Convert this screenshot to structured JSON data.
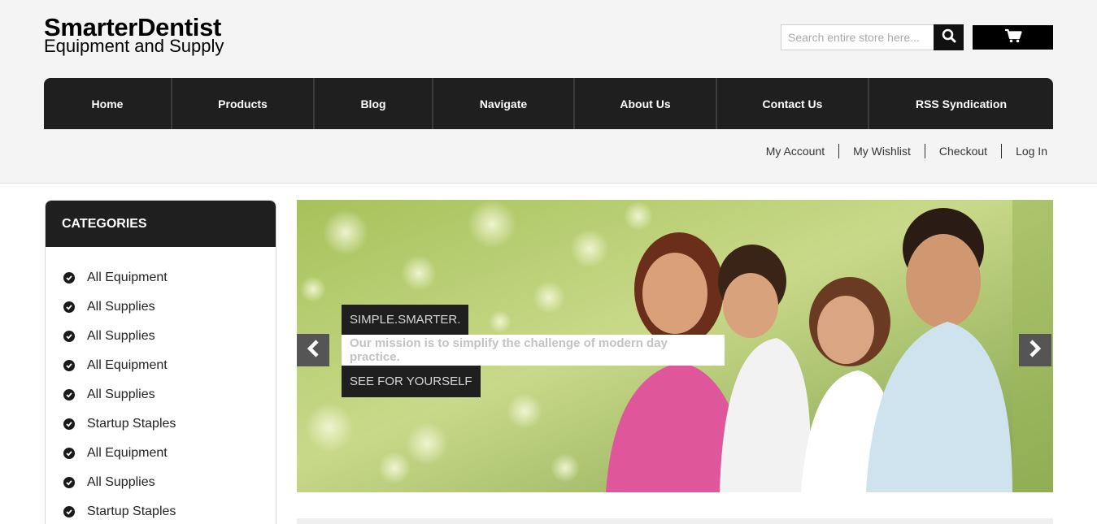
{
  "brand": {
    "title": "SmarterDentist",
    "subtitle": "Equipment and Supply"
  },
  "search": {
    "placeholder": "Search entire store here...",
    "icon": "search-icon"
  },
  "cart": {
    "icon": "shopping-cart-icon"
  },
  "nav": {
    "items": [
      {
        "label": "Home"
      },
      {
        "label": "Products"
      },
      {
        "label": "Blog"
      },
      {
        "label": "Navigate"
      },
      {
        "label": "About Us"
      },
      {
        "label": "Contact Us"
      },
      {
        "label": "RSS Syndication"
      }
    ]
  },
  "account_links": {
    "items": [
      {
        "label": "My Account"
      },
      {
        "label": "My Wishlist"
      },
      {
        "label": "Checkout"
      },
      {
        "label": "Log In"
      }
    ]
  },
  "categories": {
    "header": "CATEGORIES",
    "item_icon": "check-circle-icon",
    "items": [
      {
        "label": "All Equipment"
      },
      {
        "label": "All Supplies"
      },
      {
        "label": "All Supplies"
      },
      {
        "label": "All Equipment"
      },
      {
        "label": "All Supplies"
      },
      {
        "label": "Startup Staples"
      },
      {
        "label": "All Equipment"
      },
      {
        "label": "All Supplies"
      },
      {
        "label": "Startup Staples"
      }
    ]
  },
  "slider": {
    "caption_title": "SIMPLE.SMARTER.",
    "caption_text": "Our mission is to simplify the challenge of modern day practice.",
    "cta_label": "SEE FOR YOURSELF",
    "prev_icon": "chevron-left-icon",
    "next_icon": "chevron-right-icon"
  },
  "colors": {
    "nav_bg": "#1f1f1f",
    "page_band": "#f4f4f4",
    "accent_dark": "#000000"
  }
}
